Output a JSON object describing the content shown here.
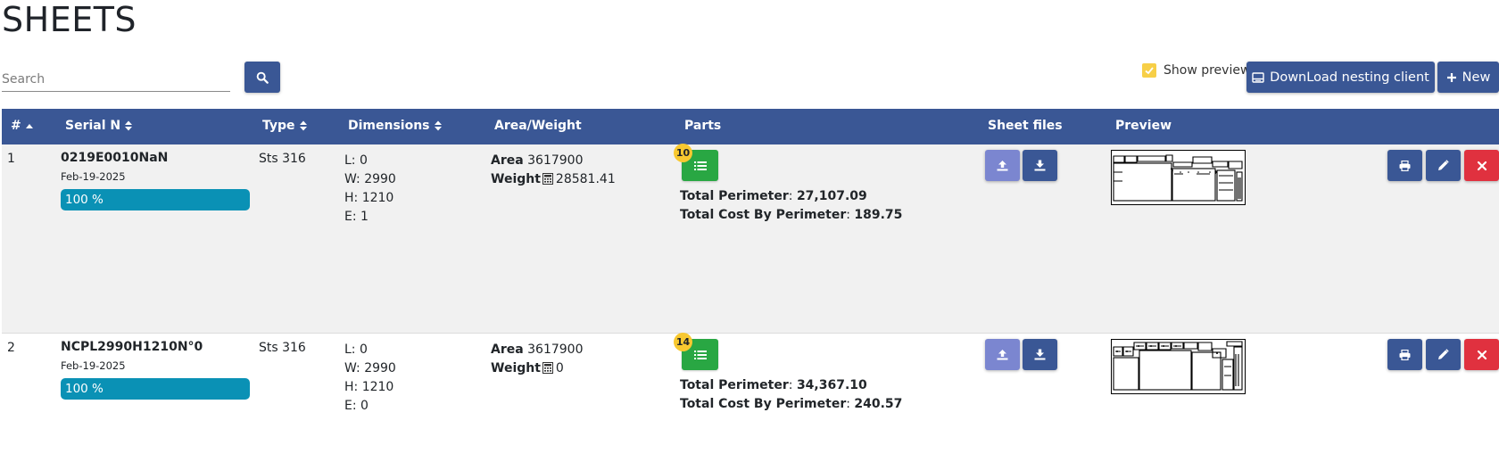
{
  "page": {
    "title": "SHEETS"
  },
  "search": {
    "placeholder": "Search",
    "value": ""
  },
  "toolbar": {
    "show_preview_label": "Show preview",
    "show_preview_checked": true,
    "download_label": "DownLoad nesting client",
    "new_label": "New"
  },
  "table": {
    "columns": [
      "#",
      "Serial N",
      "Type",
      "Dimensions",
      "Area/Weight",
      "Parts",
      "Sheet files",
      "Preview"
    ],
    "rows": [
      {
        "index": "1",
        "serial": "0219E0010NaN",
        "date": "Feb-19-2025",
        "progress_label": "100 %",
        "progress": 1.0,
        "type": "Sts 316",
        "dims": {
          "l": "L: 0",
          "w": "W: 2990",
          "h": "H: 1210",
          "e": "E: 1"
        },
        "area_label": "Area",
        "area_value": "3617900",
        "weight_label": "Weight",
        "weight_value": "28581.41",
        "parts_count": "10",
        "perimeter_label": "Total Perimeter",
        "perimeter_value": "27,107.09",
        "cost_label": "Total Cost By Perimeter",
        "cost_value": "189.75"
      },
      {
        "index": "2",
        "serial": "NCPL2990H1210N°0",
        "date": "Feb-19-2025",
        "progress_label": "100 %",
        "progress": 1.0,
        "type": "Sts 316",
        "dims": {
          "l": "L: 0",
          "w": "W: 2990",
          "h": "H: 1210",
          "e": "E: 0"
        },
        "area_label": "Area",
        "area_value": "3617900",
        "weight_label": "Weight",
        "weight_value": "0",
        "parts_count": "14",
        "perimeter_label": "Total Perimeter",
        "perimeter_value": "34,367.10",
        "cost_label": "Total Cost By Perimeter",
        "cost_value": "240.57"
      }
    ]
  },
  "colors": {
    "header": "#3a5795",
    "progress": "#0a91b5",
    "parts_button": "#29a743",
    "badge": "#f8c830",
    "upload_button": "#7b86d0",
    "delete_button": "#e0313f",
    "checkbox": "#f7cf47"
  },
  "icons": [
    "search-icon",
    "checkmark-icon",
    "monitor-icon",
    "plus-icon",
    "sort-asc-icon",
    "sort-icon",
    "calculator-icon",
    "list-icon",
    "upload-icon",
    "download-icon",
    "print-icon",
    "pencil-icon",
    "close-icon"
  ]
}
